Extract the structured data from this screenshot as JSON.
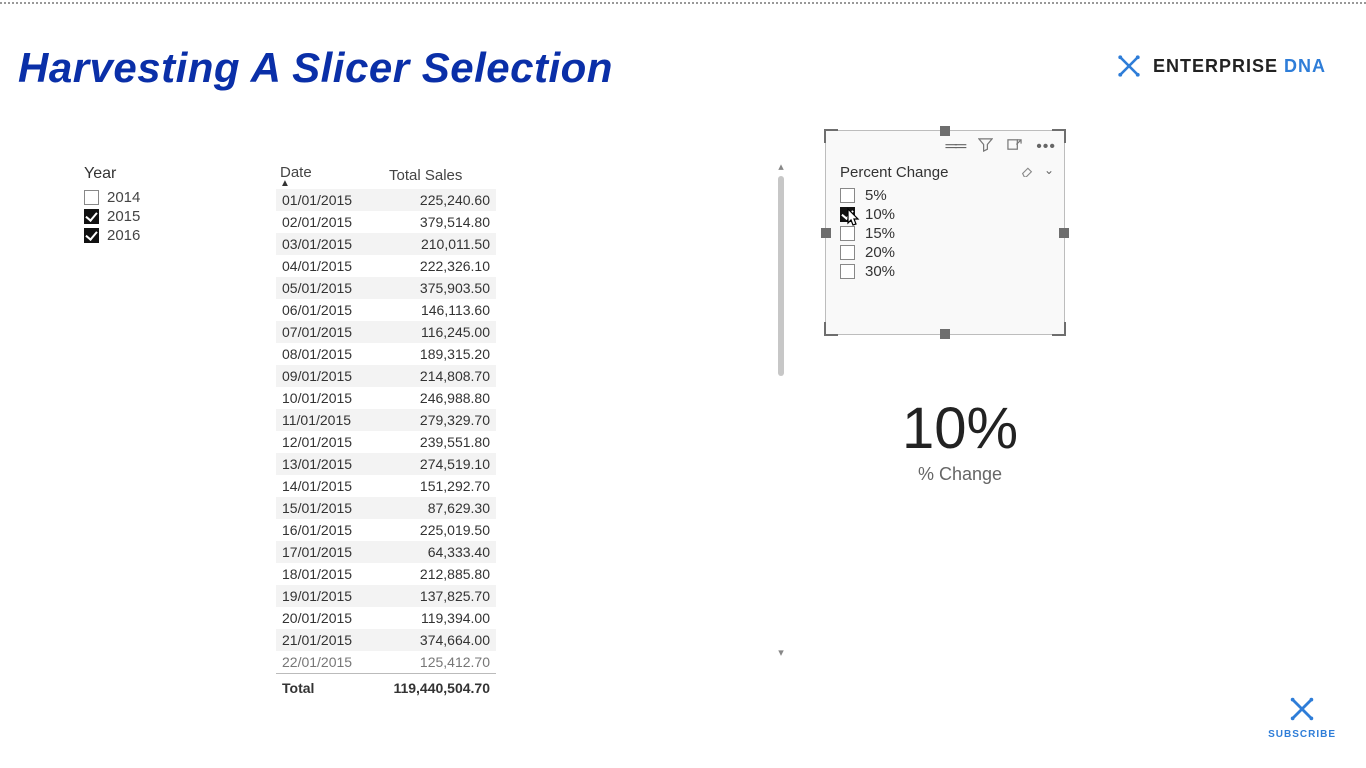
{
  "title": "Harvesting A Slicer Selection",
  "brand": {
    "text1": "ENTERPRISE",
    "text2": "DNA"
  },
  "year_slicer": {
    "title": "Year",
    "items": [
      {
        "label": "2014",
        "checked": false
      },
      {
        "label": "2015",
        "checked": true
      },
      {
        "label": "2016",
        "checked": true
      }
    ]
  },
  "table": {
    "col_date": "Date",
    "col_sales": "Total Sales",
    "total_label": "Total",
    "total_value": "119,440,504.70",
    "rows": [
      {
        "date": "01/01/2015",
        "value": "225,240.60"
      },
      {
        "date": "02/01/2015",
        "value": "379,514.80"
      },
      {
        "date": "03/01/2015",
        "value": "210,011.50"
      },
      {
        "date": "04/01/2015",
        "value": "222,326.10"
      },
      {
        "date": "05/01/2015",
        "value": "375,903.50"
      },
      {
        "date": "06/01/2015",
        "value": "146,113.60"
      },
      {
        "date": "07/01/2015",
        "value": "116,245.00"
      },
      {
        "date": "08/01/2015",
        "value": "189,315.20"
      },
      {
        "date": "09/01/2015",
        "value": "214,808.70"
      },
      {
        "date": "10/01/2015",
        "value": "246,988.80"
      },
      {
        "date": "11/01/2015",
        "value": "279,329.70"
      },
      {
        "date": "12/01/2015",
        "value": "239,551.80"
      },
      {
        "date": "13/01/2015",
        "value": "274,519.10"
      },
      {
        "date": "14/01/2015",
        "value": "151,292.70"
      },
      {
        "date": "15/01/2015",
        "value": "87,629.30"
      },
      {
        "date": "16/01/2015",
        "value": "225,019.50"
      },
      {
        "date": "17/01/2015",
        "value": "64,333.40"
      },
      {
        "date": "18/01/2015",
        "value": "212,885.80"
      },
      {
        "date": "19/01/2015",
        "value": "137,825.70"
      },
      {
        "date": "20/01/2015",
        "value": "119,394.00"
      },
      {
        "date": "21/01/2015",
        "value": "374,664.00"
      }
    ],
    "cutoff": {
      "date": "22/01/2015",
      "value": "125,412.70"
    }
  },
  "pct_slicer": {
    "title": "Percent Change",
    "items": [
      {
        "label": "5%",
        "checked": false
      },
      {
        "label": "10%",
        "checked": true
      },
      {
        "label": "15%",
        "checked": false
      },
      {
        "label": "20%",
        "checked": false
      },
      {
        "label": "30%",
        "checked": false
      }
    ]
  },
  "card": {
    "value": "10%",
    "label": "% Change"
  },
  "subscribe": "SUBSCRIBE"
}
